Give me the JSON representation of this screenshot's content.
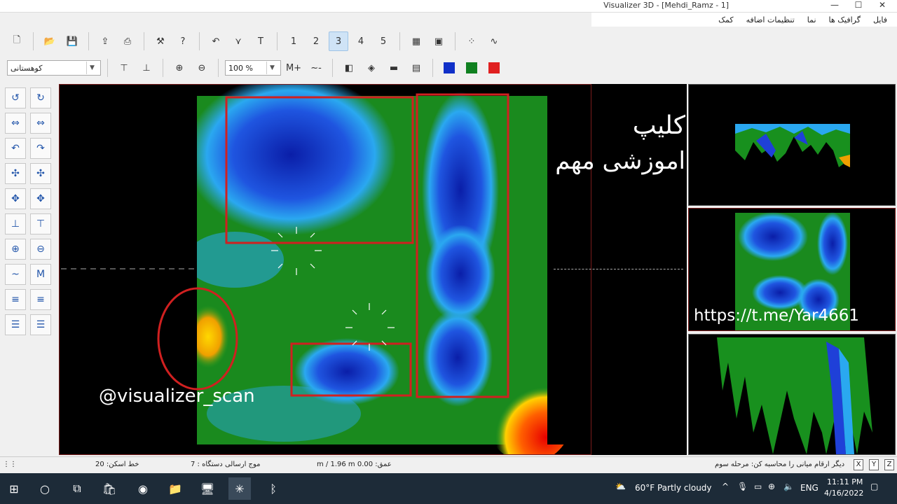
{
  "window": {
    "title": "Visualizer 3D - [Mehdi_Ramz - 1]",
    "min_label": "—",
    "max_label": "☐",
    "close_label": "✕"
  },
  "menu": [
    "فایل",
    "گرافیک ها",
    "نما",
    "تنظیمات اضافه",
    "کمک"
  ],
  "toolbar": {
    "view_numbers": [
      "1",
      "2",
      "3",
      "4",
      "5"
    ],
    "selected_view": "3",
    "terrain_select": "کوهستانی",
    "zoom_value": "100 %",
    "color_squares": [
      "#1030c8",
      "#108020",
      "#e02020"
    ]
  },
  "overlay": {
    "watermark": "@visualizer_scan",
    "clip_line1": "کلیپ",
    "clip_line2": "اموزشی مهم",
    "link": "https://t.me/Yar4661"
  },
  "status": {
    "scan_lines": "خط اسکن: 20",
    "device_lines": "موج ارسالی دستگاه : 7",
    "depth": "عمق: 0.00 m / 1.96 m",
    "hint": "دیگر ارقام میانی را محاسبه کن: مرحله سوم",
    "axes": [
      "X",
      "Y",
      "Z"
    ]
  },
  "taskbar": {
    "weather": "60°F  Partly cloudy",
    "lang": "ENG",
    "time": "11:11 PM",
    "date": "4/16/2022"
  }
}
